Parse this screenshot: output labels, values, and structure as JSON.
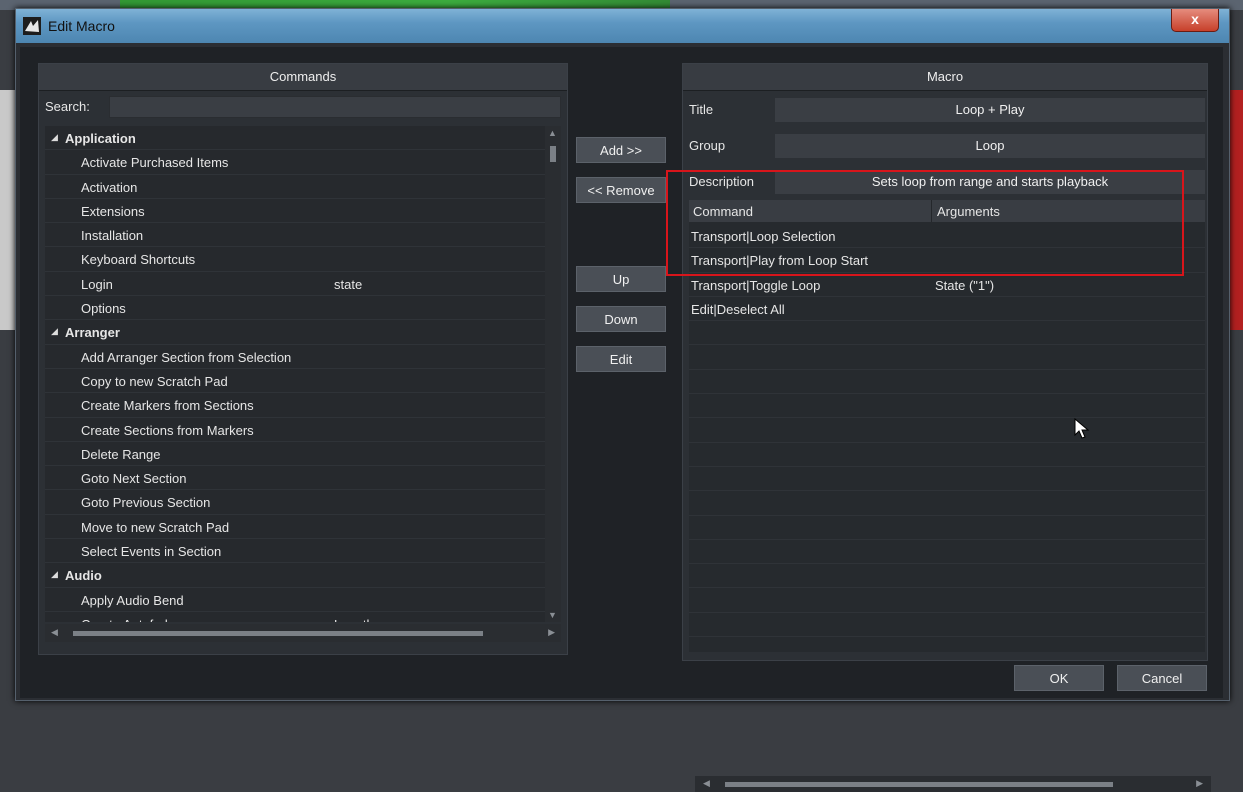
{
  "window": {
    "title": "Edit Macro",
    "close_glyph": "x"
  },
  "commands": {
    "header": "Commands",
    "search_label": "Search:",
    "search_value": "",
    "tree": [
      {
        "type": "group",
        "label": "Application"
      },
      {
        "type": "item",
        "label": "Activate Purchased Items",
        "arg": ""
      },
      {
        "type": "item",
        "label": "Activation",
        "arg": ""
      },
      {
        "type": "item",
        "label": "Extensions",
        "arg": ""
      },
      {
        "type": "item",
        "label": "Installation",
        "arg": ""
      },
      {
        "type": "item",
        "label": "Keyboard Shortcuts",
        "arg": ""
      },
      {
        "type": "item",
        "label": "Login",
        "arg": "state"
      },
      {
        "type": "item",
        "label": "Options",
        "arg": ""
      },
      {
        "type": "group",
        "label": "Arranger"
      },
      {
        "type": "item",
        "label": "Add Arranger Section from Selection",
        "arg": ""
      },
      {
        "type": "item",
        "label": "Copy to new Scratch Pad",
        "arg": ""
      },
      {
        "type": "item",
        "label": "Create Markers from Sections",
        "arg": ""
      },
      {
        "type": "item",
        "label": "Create Sections from Markers",
        "arg": ""
      },
      {
        "type": "item",
        "label": "Delete Range",
        "arg": ""
      },
      {
        "type": "item",
        "label": "Goto Next Section",
        "arg": ""
      },
      {
        "type": "item",
        "label": "Goto Previous Section",
        "arg": ""
      },
      {
        "type": "item",
        "label": "Move to new Scratch Pad",
        "arg": ""
      },
      {
        "type": "item",
        "label": "Select Events in Section",
        "arg": ""
      },
      {
        "type": "group",
        "label": "Audio"
      },
      {
        "type": "item",
        "label": "Apply Audio Bend",
        "arg": ""
      },
      {
        "type": "item",
        "label": "Create Autofades",
        "arg": "Length"
      }
    ]
  },
  "buttons": {
    "add": "Add >>",
    "remove": "<< Remove",
    "up": "Up",
    "down": "Down",
    "edit": "Edit",
    "ok": "OK",
    "cancel": "Cancel"
  },
  "macro": {
    "header": "Macro",
    "title_label": "Title",
    "title_value": "Loop + Play",
    "group_label": "Group",
    "group_value": "Loop",
    "description_label": "Description",
    "description_value": "Sets loop from range and starts playback",
    "columns": {
      "command": "Command",
      "arguments": "Arguments"
    },
    "rows": [
      {
        "command": "Transport|Loop Selection",
        "arguments": ""
      },
      {
        "command": "Transport|Play from Loop Start",
        "arguments": ""
      },
      {
        "command": "Transport|Toggle Loop",
        "arguments": "State (\"1\")"
      },
      {
        "command": "Edit|Deselect All",
        "arguments": ""
      }
    ]
  },
  "colors": {
    "highlight": "#d8151b",
    "titlebar": "#5e97c2",
    "panel_bg": "#2c3035"
  },
  "icons": [
    "app-icon",
    "close-icon",
    "expand-triangle-icon",
    "scroll-arrow-icon",
    "mouse-cursor-icon"
  ]
}
